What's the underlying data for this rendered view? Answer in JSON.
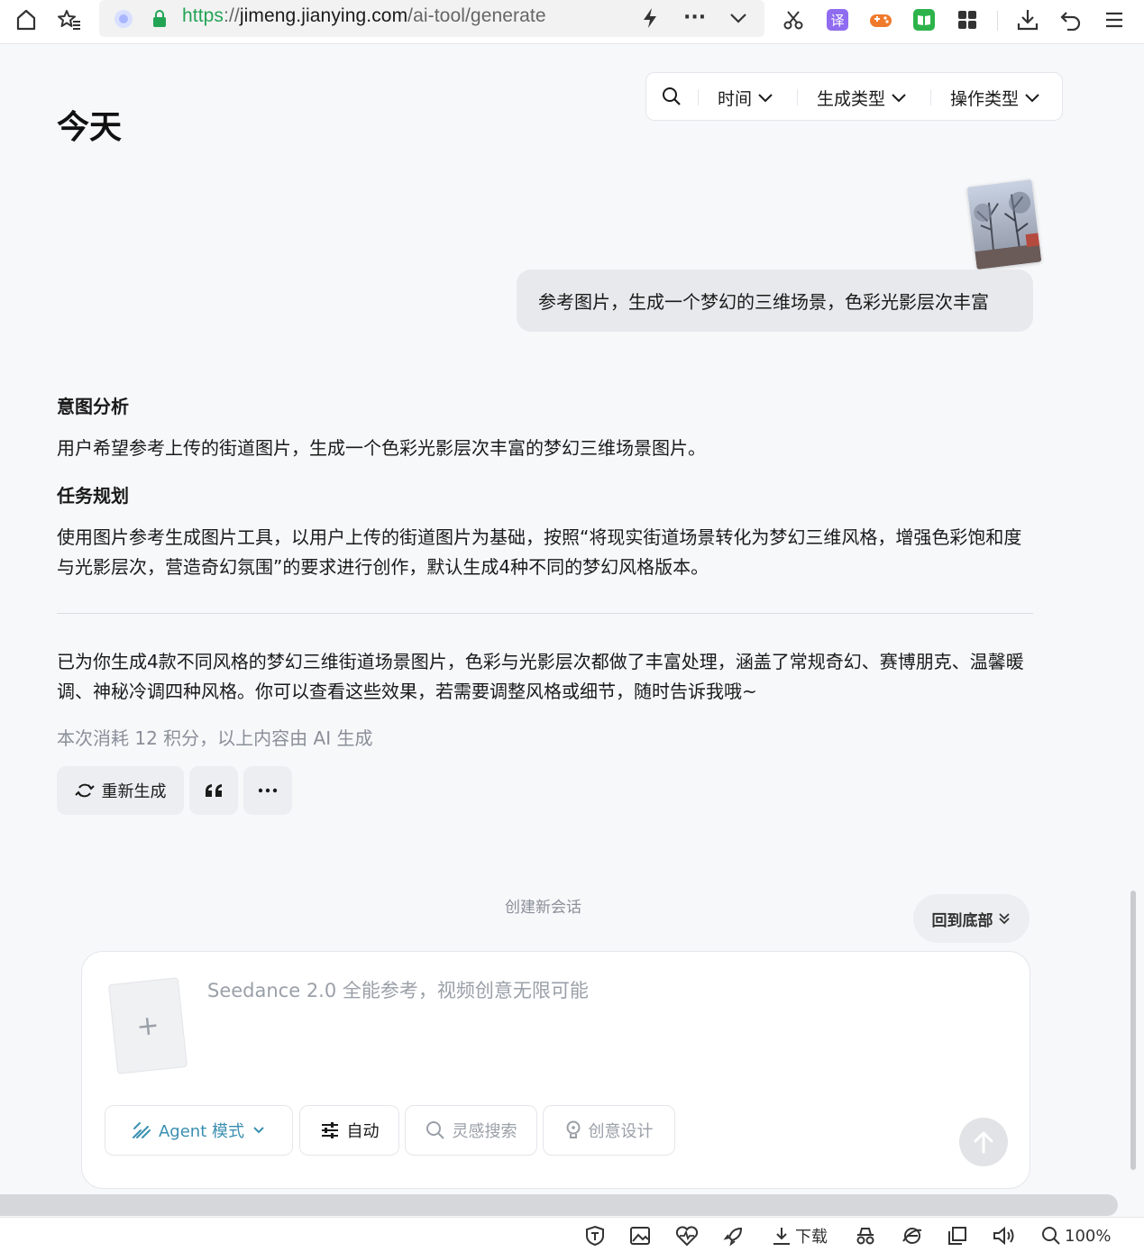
{
  "browser": {
    "url_scheme": "https",
    "url_sep": "://",
    "url_domain": "jimeng.jianying.com",
    "url_path": "/ai-tool/generate",
    "translate_badge": "译",
    "status": {
      "download_label": "下载",
      "zoom": "100%"
    }
  },
  "filters": {
    "time": "时间",
    "gen_type": "生成类型",
    "op_type": "操作类型"
  },
  "page": {
    "date_header": "今天"
  },
  "conversation": {
    "user_message": "参考图片，生成一个梦幻的三维场景，色彩光影层次丰富",
    "intent_title": "意图分析",
    "intent_text": "用户希望参考上传的街道图片，生成一个色彩光影层次丰富的梦幻三维场景图片。",
    "plan_title": "任务规划",
    "plan_text": "使用图片参考生成图片工具，以用户上传的街道图片为基础，按照“将现实街道场景转化为梦幻三维风格，增强色彩饱和度与光影层次，营造奇幻氛围”的要求进行创作，默认生成4种不同的梦幻风格版本。",
    "result_text": "已为你生成4款不同风格的梦幻三维街道场景图片，色彩与光影层次都做了丰富处理，涵盖了常规奇幻、赛博朋克、温馨暖调、神秘冷调四种风格。你可以查看这些效果，若需要调整风格或细节，随时告诉我哦~",
    "meta": "本次消耗 12 积分，以上内容由 AI 生成",
    "regenerate": "重新生成"
  },
  "bottom": {
    "new_session": "创建新会话",
    "back_to_bottom": "回到底部"
  },
  "composer": {
    "placeholder": "Seedance 2.0 全能参考，视频创意无限可能",
    "upload_plus": "+",
    "agent_mode": "Agent 模式",
    "auto": "自动",
    "inspiration": "灵感搜索",
    "creative": "创意设计"
  },
  "colors": {
    "url_green": "#23a455",
    "agent_accent": "#3a8fb0"
  }
}
